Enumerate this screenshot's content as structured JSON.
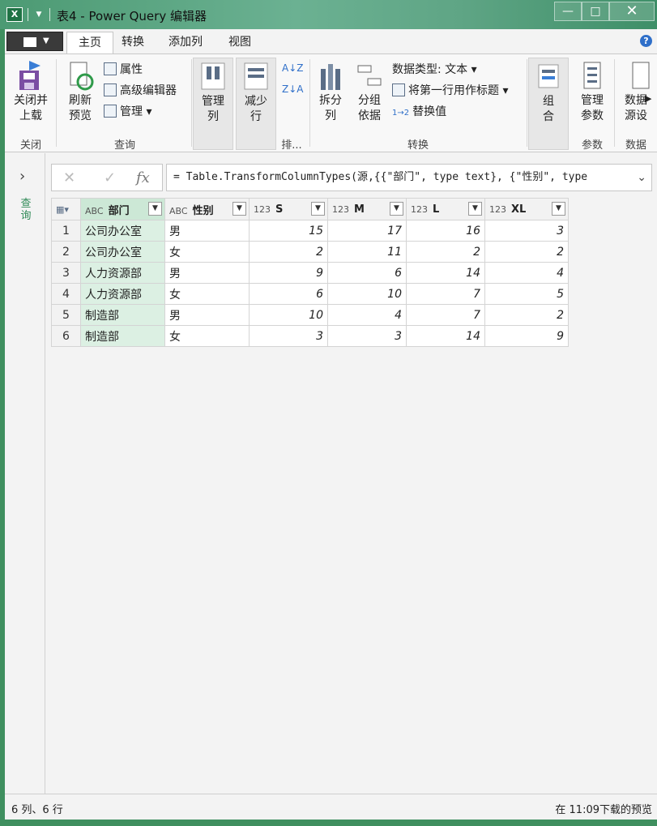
{
  "window": {
    "app_icon": "excel-icon",
    "title": "表4 - Power Query 编辑器",
    "minimize": "—",
    "maximize": "□",
    "close": "✕"
  },
  "tabs": [
    {
      "label": "主页",
      "active": true
    },
    {
      "label": "转换",
      "active": false
    },
    {
      "label": "添加列",
      "active": false
    },
    {
      "label": "视图",
      "active": false
    }
  ],
  "ribbon": {
    "close_load": "关闭并\n上载",
    "close_load_l1": "关闭并",
    "close_load_l2": "上载",
    "refresh_l1": "刷新",
    "refresh_l2": "预览",
    "properties": "属性",
    "advanced_editor": "高级编辑器",
    "manage": "管理",
    "manage_cols_l1": "管理",
    "manage_cols_l2": "列",
    "reduce_rows_l1": "减少",
    "reduce_rows_l2": "行",
    "sort_label": "排...",
    "split_l1": "拆分",
    "split_l2": "列",
    "group_l1": "分组",
    "group_l2": "依据",
    "data_type": "数据类型: 文本",
    "first_row_header": "将第一行用作标题",
    "replace_values": "替换值",
    "combine_l1": "组",
    "combine_l2": "合",
    "manage_params_l1": "管理",
    "manage_params_l2": "参数",
    "data_source_l1": "数据",
    "data_source_l2": "源设",
    "groups": {
      "close": "关闭",
      "query": "查询",
      "transform": "转换",
      "params": "参数",
      "data": "数据"
    }
  },
  "left_rail": {
    "label": "查询"
  },
  "formula_bar": {
    "cancel": "✕",
    "confirm": "✓",
    "fx": "fx",
    "text": "= Table.TransformColumnTypes(源,{{\"部门\", type text}, {\"性别\", type"
  },
  "table": {
    "columns": [
      {
        "type": "ABC",
        "name": "部门"
      },
      {
        "type": "ABC",
        "name": "性别"
      },
      {
        "type": "123",
        "name": "S"
      },
      {
        "type": "123",
        "name": "M"
      },
      {
        "type": "123",
        "name": "L"
      },
      {
        "type": "123",
        "name": "XL"
      }
    ],
    "rows": [
      {
        "n": "1",
        "dept": "公司办公室",
        "sex": "男",
        "s": "15",
        "m": "17",
        "l": "16",
        "xl": "3"
      },
      {
        "n": "2",
        "dept": "公司办公室",
        "sex": "女",
        "s": "2",
        "m": "11",
        "l": "2",
        "xl": "2"
      },
      {
        "n": "3",
        "dept": "人力资源部",
        "sex": "男",
        "s": "9",
        "m": "6",
        "l": "14",
        "xl": "4"
      },
      {
        "n": "4",
        "dept": "人力资源部",
        "sex": "女",
        "s": "6",
        "m": "10",
        "l": "7",
        "xl": "5"
      },
      {
        "n": "5",
        "dept": "制造部",
        "sex": "男",
        "s": "10",
        "m": "4",
        "l": "7",
        "xl": "2"
      },
      {
        "n": "6",
        "dept": "制造部",
        "sex": "女",
        "s": "3",
        "m": "3",
        "l": "14",
        "xl": "9"
      }
    ]
  },
  "status": {
    "left": "6 列、6 行",
    "right": "在 11:09下载的预览"
  }
}
